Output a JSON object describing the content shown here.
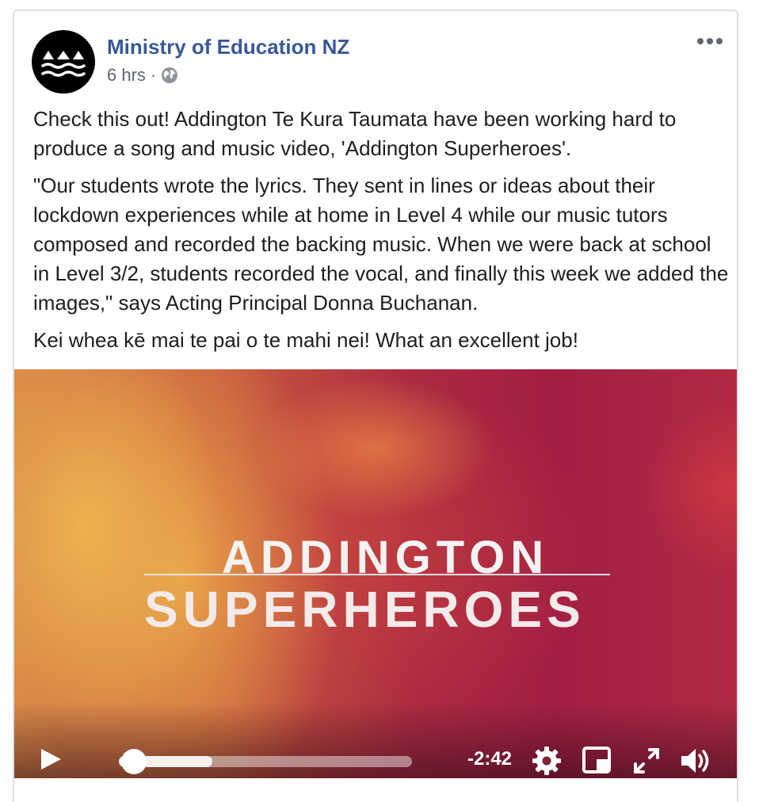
{
  "post": {
    "author": "Ministry of Education NZ",
    "time": "6 hrs",
    "separator": "·",
    "paragraphs": [
      "Check this out! Addington Te Kura Taumata have been working hard to produce a song and music video, 'Addington Superheroes'.",
      "\"Our students wrote the lyrics. They sent in lines or ideas about their lockdown experiences while at home in Level 4 while our music tutors composed and recorded the backing music. When we were back at school in Level 3/2, students recorded the vocal, and finally this week we added the images,\" says Acting Principal Donna Buchanan.",
      "Kei whea kē mai te pai o te mahi nei! What an excellent job!"
    ],
    "icons": {
      "avatar": "ministry-logo-icon",
      "privacy": "globe-icon",
      "menu": "more-options-icon"
    }
  },
  "video": {
    "title_line1": "ADDINGTON",
    "title_line2": "SUPERHEROES",
    "remaining_time": "-2:42",
    "progress_fraction": 0.05,
    "buffered_fraction": 0.32,
    "controls": [
      "play-icon",
      "settings-icon",
      "picture-in-picture-icon",
      "fullscreen-icon",
      "volume-icon"
    ]
  },
  "colors": {
    "link": "#385898",
    "text": "#1c1e21",
    "meta": "#616770"
  }
}
